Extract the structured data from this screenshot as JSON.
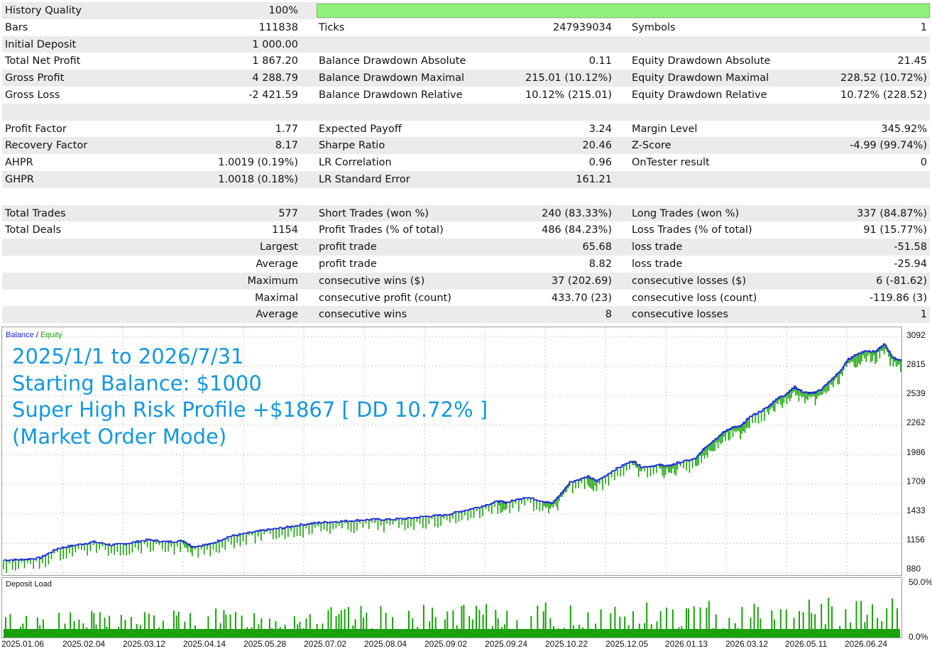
{
  "stats": {
    "rows": [
      {
        "c1": "History Quality",
        "v1": "100%",
        "c2": "",
        "v2": "",
        "c3": "",
        "v3": "",
        "bar": 1.0
      },
      {
        "c1": "Bars",
        "v1": "111838",
        "c2": "Ticks",
        "v2": "247939034",
        "c3": "Symbols",
        "v3": "1"
      },
      {
        "c1": "Initial Deposit",
        "v1": "1 000.00",
        "c2": "",
        "v2": "",
        "c3": "",
        "v3": ""
      },
      {
        "c1": "Total Net Profit",
        "v1": "1 867.20",
        "c2": "Balance Drawdown Absolute",
        "v2": "0.11",
        "c3": "Equity Drawdown Absolute",
        "v3": "21.45"
      },
      {
        "c1": "Gross Profit",
        "v1": "4 288.79",
        "c2": "Balance Drawdown Maximal",
        "v2": "215.01 (10.12%)",
        "c3": "Equity Drawdown Maximal",
        "v3": "228.52 (10.72%)"
      },
      {
        "c1": "Gross Loss",
        "v1": "-2 421.59",
        "c2": "Balance Drawdown Relative",
        "v2": "10.12% (215.01)",
        "c3": "Equity Drawdown Relative",
        "v3": "10.72% (228.52)"
      },
      {
        "c1": "",
        "v1": "",
        "c2": "",
        "v2": "",
        "c3": "",
        "v3": ""
      },
      {
        "c1": "Profit Factor",
        "v1": "1.77",
        "c2": "Expected Payoff",
        "v2": "3.24",
        "c3": "Margin Level",
        "v3": "345.92%"
      },
      {
        "c1": "Recovery Factor",
        "v1": "8.17",
        "c2": "Sharpe Ratio",
        "v2": "20.46",
        "c3": "Z-Score",
        "v3": "-4.99 (99.74%)"
      },
      {
        "c1": "AHPR",
        "v1": "1.0019 (0.19%)",
        "c2": "LR Correlation",
        "v2": "0.96",
        "c3": "OnTester result",
        "v3": "0"
      },
      {
        "c1": "GHPR",
        "v1": "1.0018 (0.18%)",
        "c2": "LR Standard Error",
        "v2": "161.21",
        "c3": "",
        "v3": ""
      },
      {
        "c1": "",
        "v1": "",
        "c2": "",
        "v2": "",
        "c3": "",
        "v3": ""
      },
      {
        "c1": "Total Trades",
        "v1": "577",
        "c2": "Short Trades (won %)",
        "v2": "240 (83.33%)",
        "c3": "Long Trades (won %)",
        "v3": "337 (84.87%)"
      },
      {
        "c1": "Total Deals",
        "v1": "1154",
        "c2": "Profit Trades (% of total)",
        "v2": "486 (84.23%)",
        "c3": "Loss Trades (% of total)",
        "v3": "91 (15.77%)"
      },
      {
        "c1": "",
        "v1": "Largest",
        "c2": "profit trade",
        "v2": "65.68",
        "c3": "loss trade",
        "v3": "-51.58"
      },
      {
        "c1": "",
        "v1": "Average",
        "c2": "profit trade",
        "v2": "8.82",
        "c3": "loss trade",
        "v3": "-25.94"
      },
      {
        "c1": "",
        "v1": "Maximum",
        "c2": "consecutive wins ($)",
        "v2": "37 (202.69)",
        "c3": "consecutive losses ($)",
        "v3": "6 (-81.62)"
      },
      {
        "c1": "",
        "v1": "Maximal",
        "c2": "consecutive profit (count)",
        "v2": "433.70 (23)",
        "c3": "consecutive loss (count)",
        "v3": "-119.86 (3)"
      },
      {
        "c1": "",
        "v1": "Average",
        "c2": "consecutive wins",
        "v2": "8",
        "c3": "consecutive losses",
        "v3": "1"
      }
    ]
  },
  "chart_data": {
    "type": "line",
    "legend": {
      "balance": "Balance",
      "separator": "/",
      "equity": "Equity"
    },
    "overlay_text": [
      "2025/1/1 to 2026/7/31",
      "Starting Balance: $1000",
      "Super High Risk Profile +$1867 [ DD 10.72% ]",
      "(Market Order Mode)"
    ],
    "y_ticks": [
      "3092",
      "2815",
      "2539",
      "2262",
      "1986",
      "1709",
      "1433",
      "1156",
      "880"
    ],
    "ylim": [
      880,
      3092
    ],
    "x_ticks": [
      "2025.01.06",
      "2025.02.04",
      "2025.03.12",
      "2025.04.14",
      "2025.05.28",
      "2025.07.02",
      "2025.08.04",
      "2025.09.02",
      "2025.09.24",
      "2025.10.22",
      "2025.12.05",
      "2026.01.13",
      "2026.03.12",
      "2026.05.11",
      "2026.06.24"
    ],
    "series": [
      {
        "name": "Balance",
        "color": "#1a2bd6",
        "points": [
          [
            0,
            1000
          ],
          [
            0.02,
            1005
          ],
          [
            0.04,
            1020
          ],
          [
            0.06,
            1110
          ],
          [
            0.08,
            1140
          ],
          [
            0.1,
            1170
          ],
          [
            0.12,
            1140
          ],
          [
            0.14,
            1160
          ],
          [
            0.16,
            1190
          ],
          [
            0.18,
            1170
          ],
          [
            0.2,
            1180
          ],
          [
            0.21,
            1125
          ],
          [
            0.23,
            1150
          ],
          [
            0.25,
            1220
          ],
          [
            0.27,
            1250
          ],
          [
            0.29,
            1280
          ],
          [
            0.31,
            1300
          ],
          [
            0.33,
            1330
          ],
          [
            0.35,
            1350
          ],
          [
            0.37,
            1360
          ],
          [
            0.39,
            1370
          ],
          [
            0.41,
            1380
          ],
          [
            0.43,
            1380
          ],
          [
            0.45,
            1390
          ],
          [
            0.47,
            1410
          ],
          [
            0.49,
            1420
          ],
          [
            0.51,
            1460
          ],
          [
            0.53,
            1500
          ],
          [
            0.55,
            1550
          ],
          [
            0.56,
            1540
          ],
          [
            0.58,
            1590
          ],
          [
            0.6,
            1550
          ],
          [
            0.61,
            1530
          ],
          [
            0.62,
            1620
          ],
          [
            0.63,
            1730
          ],
          [
            0.65,
            1780
          ],
          [
            0.66,
            1740
          ],
          [
            0.68,
            1850
          ],
          [
            0.7,
            1930
          ],
          [
            0.71,
            1870
          ],
          [
            0.73,
            1890
          ],
          [
            0.74,
            1880
          ],
          [
            0.75,
            1910
          ],
          [
            0.77,
            1950
          ],
          [
            0.78,
            2050
          ],
          [
            0.79,
            2120
          ],
          [
            0.8,
            2190
          ],
          [
            0.81,
            2240
          ],
          [
            0.82,
            2250
          ],
          [
            0.83,
            2340
          ],
          [
            0.85,
            2430
          ],
          [
            0.86,
            2510
          ],
          [
            0.87,
            2550
          ],
          [
            0.88,
            2620
          ],
          [
            0.89,
            2570
          ],
          [
            0.9,
            2560
          ],
          [
            0.91,
            2600
          ],
          [
            0.92,
            2680
          ],
          [
            0.93,
            2760
          ],
          [
            0.94,
            2880
          ],
          [
            0.95,
            2930
          ],
          [
            0.96,
            2960
          ],
          [
            0.97,
            2950
          ],
          [
            0.98,
            3020
          ],
          [
            0.99,
            2890
          ],
          [
            1.0,
            2867
          ]
        ]
      },
      {
        "name": "Equity",
        "color": "#19a10a"
      }
    ]
  },
  "deposit_load": {
    "title": "Deposit Load",
    "top_label": "50.0%",
    "bottom_label": "0.0%",
    "color": "#19a10a"
  }
}
